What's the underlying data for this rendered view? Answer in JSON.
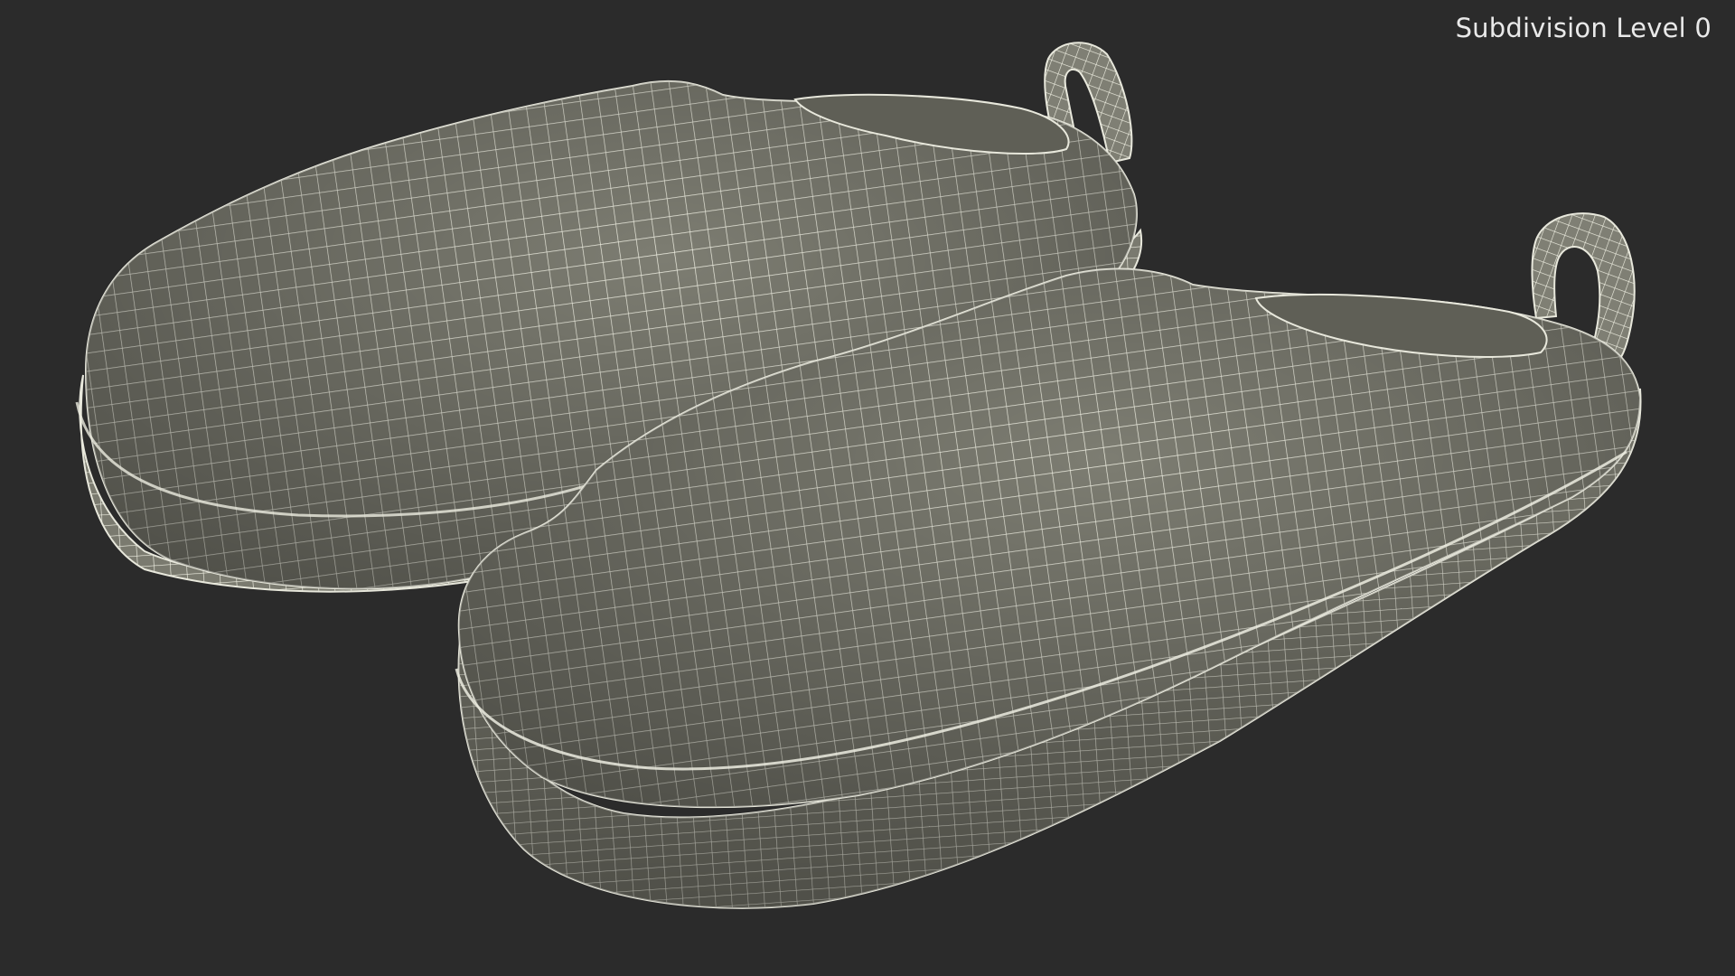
{
  "viewport": {
    "background": "#2b2b2b",
    "subdivision_label": "Subdivision Level 0"
  },
  "model": {
    "subject": "pair of slippers with heel pull tabs",
    "display_mode": "wireframe on shaded",
    "surface_color": "#7d7d72",
    "wire_color": "#f2f2e6"
  }
}
